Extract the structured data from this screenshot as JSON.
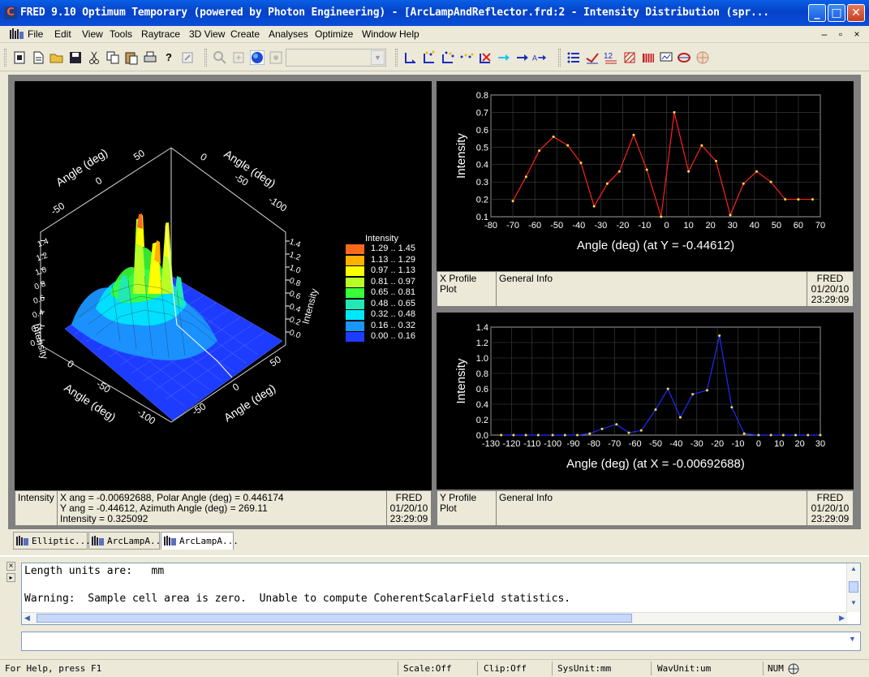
{
  "window": {
    "title": "FRED 9.10 Optimum Temporary (powered by Photon Engineering) - [ArcLampAndReflector.frd:2 - Intensity Distribution (spr...",
    "minimize": "_",
    "maximize": "□",
    "close": "✕"
  },
  "menu": {
    "items": [
      "File",
      "Edit",
      "View",
      "Tools",
      "Raytrace",
      "3D View",
      "Create",
      "Analyses",
      "Optimize",
      "Window",
      "Help"
    ],
    "mdi_controls": [
      "–",
      "▫",
      "×"
    ]
  },
  "toolbar": {
    "icons": [
      "new-icon",
      "new-doc-icon",
      "open-icon",
      "save-icon",
      "cut-icon",
      "copy-icon",
      "paste-icon",
      "print-icon",
      "help-icon",
      "edit-icon",
      "zoom-icon",
      "fit-icon",
      "globe-icon",
      "view-icon",
      "ray-start-icon",
      "ray-scatter-icon",
      "ray-trace-icon",
      "ray-grid-icon",
      "ray-stop-icon",
      "arrow-cyan-icon",
      "arrow-blue-icon",
      "arrow-label-icon",
      "list-icon",
      "line-icon",
      "numbers-icon",
      "hatch-icon",
      "bars-icon",
      "chart-icon",
      "target-icon",
      "sphere-icon"
    ],
    "combo_value": ""
  },
  "surface_plot": {
    "legend_title": "Intensity",
    "legend": [
      {
        "label": "1.29 .. 1.45",
        "color": "#ff6a1a"
      },
      {
        "label": "1.13 .. 1.29",
        "color": "#ffb000"
      },
      {
        "label": "0.97 .. 1.13",
        "color": "#ffff00"
      },
      {
        "label": "0.81 .. 0.97",
        "color": "#b8ff28"
      },
      {
        "label": "0.65 .. 0.81",
        "color": "#38ff38"
      },
      {
        "label": "0.48 .. 0.65",
        "color": "#22e8b4"
      },
      {
        "label": "0.32 .. 0.48",
        "color": "#00e8ff"
      },
      {
        "label": "0.16 .. 0.32",
        "color": "#1a96ff"
      },
      {
        "label": "0.00 .. 0.16",
        "color": "#1e3cff"
      }
    ],
    "axis_label_top_left": "Angle (deg)",
    "axis_label_top_right": "Angle (deg)",
    "axis_label_bottom_left": "Angle (deg)",
    "axis_label_bottom_right": "Angle (deg)",
    "z_label_left": "Intensity",
    "z_label_right": "Intensity",
    "ticks_top_left": [
      "-50",
      "0",
      "50"
    ],
    "ticks_top_right": [
      "0",
      "-50",
      "-100"
    ],
    "ticks_bottom_left": [
      "0",
      "-50",
      "-100"
    ],
    "ticks_bottom_right": [
      "50",
      "0",
      "-50"
    ],
    "z_ticks": [
      "0.0",
      "0.2",
      "0.4",
      "0.6",
      "0.8",
      "1.0",
      "1.2",
      "1.4"
    ],
    "info": {
      "label": "Intensity",
      "line1": "X ang = -0.00692688,   Polar Angle  (deg) = 0.446174",
      "line2": "Y ang = -0.44612,   Azimuth Angle (deg) = 269.11",
      "line3": "Intensity = 0.325092",
      "stamp1": "FRED",
      "stamp2": "01/20/10",
      "stamp3": "23:29:09"
    }
  },
  "chart_data": [
    {
      "type": "line",
      "title": "",
      "xlabel": "Angle (deg) (at Y = -0.44612)",
      "ylabel": "Intensity",
      "xlim": [
        -80,
        70
      ],
      "ylim": [
        0.1,
        0.8
      ],
      "xticks": [
        -80,
        -70,
        -60,
        -50,
        -40,
        -30,
        -20,
        -10,
        0,
        10,
        20,
        30,
        40,
        50,
        60,
        70
      ],
      "yticks": [
        0.1,
        0.2,
        0.3,
        0.4,
        0.5,
        0.6,
        0.7,
        0.8
      ],
      "grid": true,
      "color": "#ff2020",
      "x": [
        -70,
        -64,
        -58,
        -51.5,
        -45,
        -39,
        -33,
        -27,
        -21.5,
        -15,
        -9,
        -2.5,
        3.5,
        10,
        16,
        22.5,
        29,
        35,
        41,
        47.5,
        54,
        60,
        66.5
      ],
      "y": [
        0.19,
        0.33,
        0.48,
        0.56,
        0.51,
        0.41,
        0.16,
        0.29,
        0.36,
        0.57,
        0.37,
        0.1,
        0.7,
        0.36,
        0.51,
        0.42,
        0.11,
        0.29,
        0.36,
        0.3,
        0.2,
        0.2,
        0.2
      ],
      "info": {
        "label": "X Profile Plot",
        "general": "General Info",
        "stamp1": "FRED",
        "stamp2": "01/20/10",
        "stamp3": "23:29:09"
      }
    },
    {
      "type": "line",
      "title": "",
      "xlabel": "Angle (deg) (at X = -0.00692688)",
      "ylabel": "Intensity",
      "xlim": [
        -130,
        30
      ],
      "ylim": [
        0,
        1.4
      ],
      "xticks": [
        -130,
        -120,
        -110,
        -100,
        -90,
        -80,
        -70,
        -60,
        -50,
        -40,
        -30,
        -20,
        -10,
        0,
        10,
        20,
        30
      ],
      "yticks": [
        0.0,
        0.2,
        0.4,
        0.6,
        0.8,
        1.0,
        1.2,
        1.4
      ],
      "grid": true,
      "color": "#1c2cff",
      "x": [
        -125,
        -119,
        -113,
        -107,
        -100,
        -94,
        -88,
        -82,
        -76,
        -69,
        -63,
        -57,
        -50,
        -44,
        -38,
        -32,
        -25,
        -19,
        -13,
        -7,
        0,
        6,
        12,
        18,
        24,
        30
      ],
      "y": [
        0,
        0,
        0,
        0,
        0,
        0,
        0,
        0.02,
        0.08,
        0.14,
        0.03,
        0.06,
        0.33,
        0.6,
        0.23,
        0.53,
        0.58,
        1.29,
        0.36,
        0.02,
        0,
        0,
        0,
        0,
        0,
        0
      ],
      "info": {
        "label": "Y Profile Plot",
        "general": "General Info",
        "stamp1": "FRED",
        "stamp2": "01/20/10",
        "stamp3": "23:29:09"
      }
    }
  ],
  "tabs": [
    "Elliptic...",
    "ArcLampA...",
    "ArcLampA..."
  ],
  "output": {
    "line1": "Length units are:   mm",
    "line2": "Warning:  Sample cell area is zero.  Unable to compute CoherentScalarField statistics."
  },
  "status": {
    "help": "For Help, press F1",
    "scale": "Scale:Off",
    "clip": "Clip:Off",
    "sysunit": "SysUnit:mm",
    "wavunit": "WavUnit:um",
    "num": "NUM"
  }
}
